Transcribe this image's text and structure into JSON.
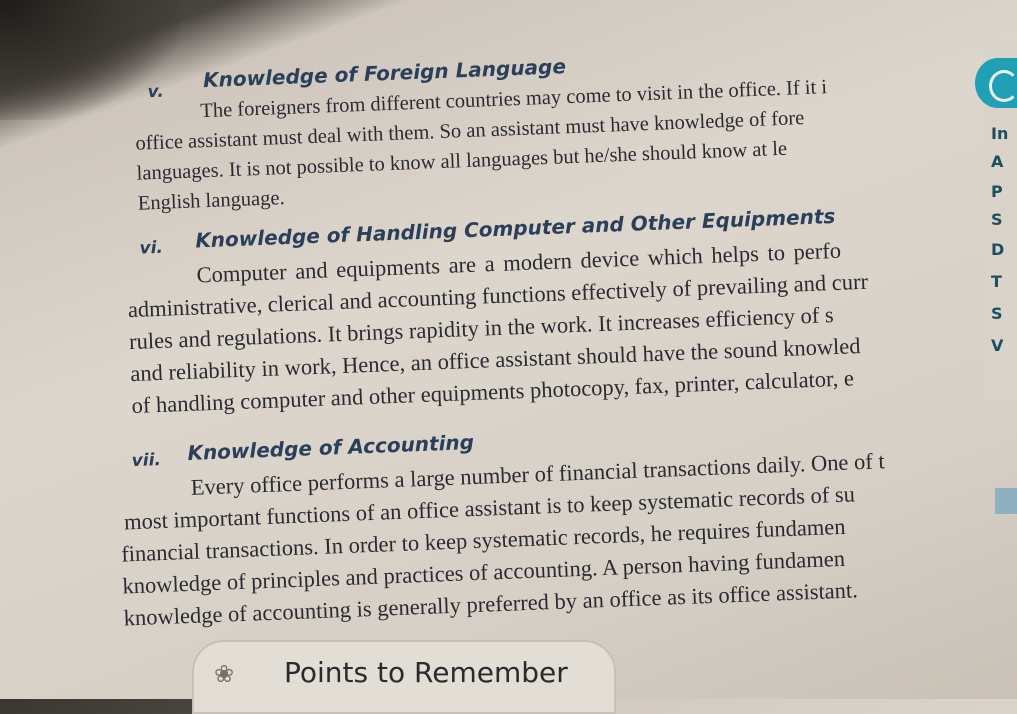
{
  "sections": [
    {
      "numeral": "v.",
      "heading": "Knowledge of Foreign Language",
      "lines": [
        "The foreigners from different countries may come to visit in the office. If it i",
        "office assistant must deal with them. So an assistant must have knowledge of fore",
        "languages. It is not possible to know all languages but he/she should know at le",
        "English language."
      ]
    },
    {
      "numeral": "vi.",
      "heading": "Knowledge of Handling Computer and Other Equipments",
      "lines": [
        "Computer and equipments are a modern device which helps to perfo",
        "administrative, clerical and accounting functions effectively of prevailing and curr",
        "rules and regulations. It brings rapidity in the work. It increases efficiency of s",
        "and reliability in work, Hence, an office assistant should have the sound knowled",
        "of handling computer and other equipments photocopy, fax, printer, calculator, e"
      ]
    },
    {
      "numeral": "vii.",
      "heading": "Knowledge of Accounting",
      "lines": [
        "Every office performs a large number of financial transactions daily. One of t",
        "most important functions of an office assistant is to keep systematic records of su",
        "financial transactions. In order to keep systematic records, he requires fundamen",
        "knowledge of principles and practices of accounting. A person having fundamen",
        "knowledge of accounting is generally preferred by an office as its office assistant."
      ]
    }
  ],
  "side_tab": {
    "letters": [
      "In",
      "A",
      "P",
      "S",
      "D",
      "T",
      "S",
      "V"
    ]
  },
  "points_box": {
    "icon": "tree-icon",
    "title": "Points to Remember"
  },
  "colors": {
    "heading": "#2c3f5a",
    "text": "#2a2a32",
    "accent": "#21a0b5"
  }
}
